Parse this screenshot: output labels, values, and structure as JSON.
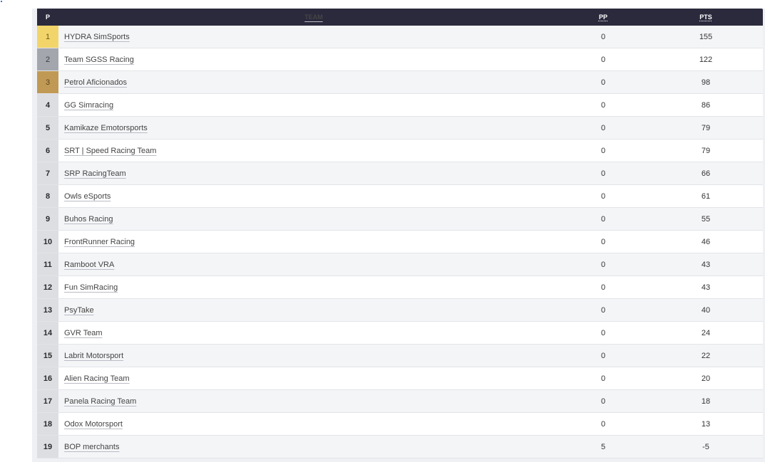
{
  "table": {
    "headers": {
      "p": "P",
      "team": "TEAM",
      "pp": "PP",
      "pts": "PTS"
    },
    "rows": [
      {
        "pos": "1",
        "team": "HYDRA SimSports",
        "pp": "0",
        "pts": "155"
      },
      {
        "pos": "2",
        "team": "Team SGSS Racing",
        "pp": "0",
        "pts": "122"
      },
      {
        "pos": "3",
        "team": "Petrol Aficionados",
        "pp": "0",
        "pts": "98"
      },
      {
        "pos": "4",
        "team": "GG Simracing",
        "pp": "0",
        "pts": "86"
      },
      {
        "pos": "5",
        "team": "Kamikaze Emotorsports",
        "pp": "0",
        "pts": "79"
      },
      {
        "pos": "6",
        "team": "SRT | Speed Racing Team",
        "pp": "0",
        "pts": "79"
      },
      {
        "pos": "7",
        "team": "SRP RacingTeam",
        "pp": "0",
        "pts": "66"
      },
      {
        "pos": "8",
        "team": "Owls eSports",
        "pp": "0",
        "pts": "61"
      },
      {
        "pos": "9",
        "team": "Buhos Racing",
        "pp": "0",
        "pts": "55"
      },
      {
        "pos": "10",
        "team": "FrontRunner Racing",
        "pp": "0",
        "pts": "46"
      },
      {
        "pos": "11",
        "team": "Ramboot VRA",
        "pp": "0",
        "pts": "43"
      },
      {
        "pos": "12",
        "team": "Fun SimRacing",
        "pp": "0",
        "pts": "43"
      },
      {
        "pos": "13",
        "team": "PsyTake",
        "pp": "0",
        "pts": "40"
      },
      {
        "pos": "14",
        "team": "GVR Team",
        "pp": "0",
        "pts": "24"
      },
      {
        "pos": "15",
        "team": "Labrit Motorsport",
        "pp": "0",
        "pts": "22"
      },
      {
        "pos": "16",
        "team": "Alien Racing Team",
        "pp": "0",
        "pts": "20"
      },
      {
        "pos": "17",
        "team": "Panela Racing Team",
        "pp": "0",
        "pts": "18"
      },
      {
        "pos": "18",
        "team": "Odox Motorsport",
        "pp": "0",
        "pts": "13"
      },
      {
        "pos": "19",
        "team": "BOP merchants",
        "pp": "5",
        "pts": "-5"
      }
    ]
  },
  "colors": {
    "header_bg": "#2b2a3d",
    "gold": "#f2d56a",
    "silver": "#a3a7ad",
    "bronze": "#c09a55"
  }
}
